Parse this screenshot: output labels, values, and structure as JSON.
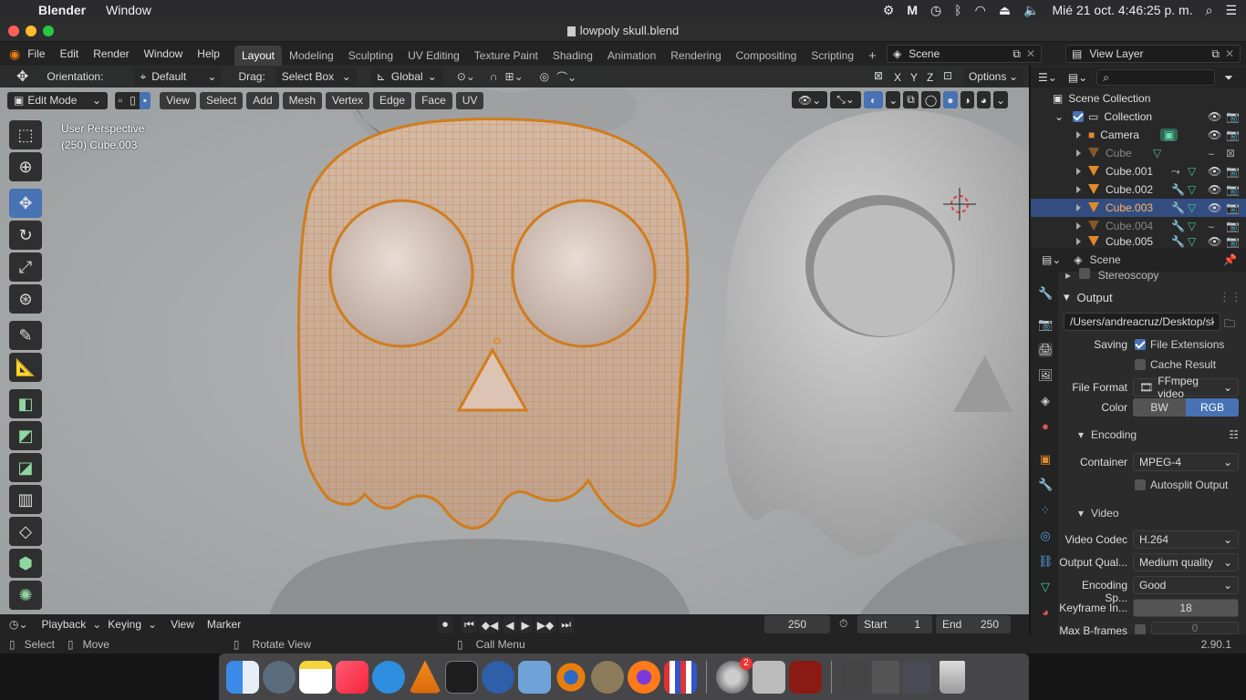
{
  "macos": {
    "app_name": "Blender",
    "menu": [
      "Window"
    ],
    "datetime": "Mié 21 oct.  4:46:25 p. m."
  },
  "window": {
    "title": "lowpoly skull.blend"
  },
  "blender_menu": [
    "File",
    "Edit",
    "Render",
    "Window",
    "Help"
  ],
  "workspaces": [
    "Layout",
    "Modeling",
    "Sculpting",
    "UV Editing",
    "Texture Paint",
    "Shading",
    "Animation",
    "Rendering",
    "Compositing",
    "Scripting"
  ],
  "active_workspace": "Layout",
  "scene_name": "Scene",
  "view_layer": "View Layer",
  "tool_header": {
    "orientation_label": "Orientation:",
    "orientation_value": "Default",
    "drag_label": "Drag:",
    "drag_value": "Select Box",
    "transform_space": "Global",
    "axes": [
      "X",
      "Y",
      "Z"
    ],
    "options_label": "Options"
  },
  "viewport": {
    "mode": "Edit Mode",
    "menus": [
      "View",
      "Select",
      "Add",
      "Mesh",
      "Vertex",
      "Edge",
      "Face",
      "UV"
    ],
    "overlay_line1": "User Perspective",
    "overlay_line2": "(250) Cube.003"
  },
  "outliner": {
    "root": "Scene Collection",
    "collection": "Collection",
    "items": [
      {
        "name": "Camera",
        "type": "camera",
        "selected": false,
        "dimmed": false
      },
      {
        "name": "Cube",
        "type": "mesh",
        "selected": false,
        "dimmed": true
      },
      {
        "name": "Cube.001",
        "type": "mesh",
        "selected": false,
        "dimmed": false
      },
      {
        "name": "Cube.002",
        "type": "mesh",
        "selected": false,
        "dimmed": false
      },
      {
        "name": "Cube.003",
        "type": "mesh",
        "selected": true,
        "dimmed": false
      },
      {
        "name": "Cube.004",
        "type": "mesh",
        "selected": false,
        "dimmed": true
      },
      {
        "name": "Cube.005",
        "type": "mesh",
        "selected": false,
        "dimmed": false
      }
    ]
  },
  "properties": {
    "context": "Scene",
    "stereoscopy": "Stereoscopy",
    "output_panel": "Output",
    "output_path": "/Users/andreacruz/Desktop/sku...",
    "saving_label": "Saving",
    "file_extensions": "File Extensions",
    "file_extensions_checked": true,
    "cache_result": "Cache Result",
    "cache_result_checked": false,
    "file_format_label": "File Format",
    "file_format": "FFmpeg video",
    "color_label": "Color",
    "color_options": [
      "BW",
      "RGB"
    ],
    "color_active": "RGB",
    "encoding_panel": "Encoding",
    "container_label": "Container",
    "container": "MPEG-4",
    "autosplit": "Autosplit Output",
    "video_panel": "Video",
    "video_codec_label": "Video Codec",
    "video_codec": "H.264",
    "output_quality_label": "Output Qual...",
    "output_quality": "Medium quality",
    "encoding_speed_label": "Encoding Sp...",
    "encoding_speed": "Good",
    "keyframe_label": "Keyframe In...",
    "keyframe_interval": "18",
    "max_bframes_label": "Max B-frames",
    "max_bframes": "0"
  },
  "timeline": {
    "menus": [
      "Playback",
      "Keying",
      "View",
      "Marker"
    ],
    "current_frame": "250",
    "start_label": "Start",
    "start": "1",
    "end_label": "End",
    "end": "250"
  },
  "statusbar": {
    "select": "Select",
    "move": "Move",
    "rotate_view": "Rotate View",
    "call_menu": "Call Menu",
    "version": "2.90.1"
  },
  "dock_badge": "2",
  "colors": {
    "accent": "#4772b3",
    "selection_orange": "#e0892a",
    "viewport_bg": "#a0a3a4"
  }
}
